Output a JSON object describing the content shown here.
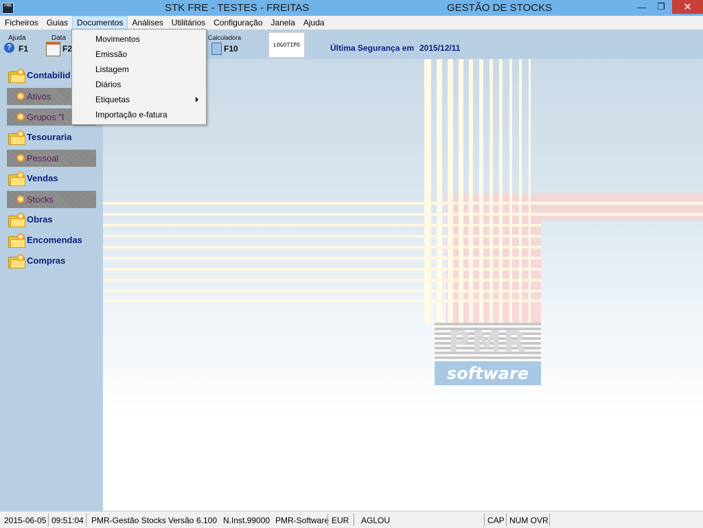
{
  "window": {
    "icon_text": "PMR",
    "title": "STK FRE - TESTES - FREITAS",
    "subtitle": "GESTÃO DE STOCKS",
    "min_glyph": "—",
    "max_glyph": "❐",
    "close_glyph": "✕"
  },
  "menubar": {
    "items": [
      "Ficheiros",
      "Guias",
      "Documentos",
      "Análises",
      "Utilitários",
      "Configuração",
      "Janela",
      "Ajuda"
    ],
    "open_index": 2
  },
  "toolbar": {
    "help_label": "Ajuda",
    "help_key": "F1",
    "help_glyph": "?",
    "date_label": "Data",
    "date_key": "F2",
    "calc_label": "Calculadora",
    "calc_key": "F10",
    "logo_text": "LOGOTIPO",
    "backup_label": "Última Segurança em",
    "backup_date": "2015/12/11"
  },
  "dropdown": {
    "items": [
      "Movimentos",
      "Emissão",
      "Listagem",
      "Diários",
      "Etiquetas",
      "Importação e-fatura"
    ],
    "submenu_index": 4
  },
  "sidebar": {
    "contabilidade": "Contabilid",
    "ativos": "Ativos",
    "grupos": "Grupos \"I",
    "tesouraria": "Tesouraria",
    "pessoal": "Pessoal",
    "vendas": "Vendas",
    "stocks": "Stocks",
    "obras": "Obras",
    "encomendas": "Encomendas",
    "compras": "Compras"
  },
  "branding": {
    "pmr": "PMR",
    "software": "software"
  },
  "statusbar": {
    "date": "2015-06-05",
    "time": "09:51:04",
    "app": "PMR-Gestão Stocks",
    "version_label": "Versão",
    "version": "6.100",
    "inst": "N.Inst.99000",
    "vendor": "PMR-Software",
    "currency": "EUR",
    "user": "AGLOU",
    "cap": "CAP",
    "num_ovr": "NUM OVR"
  },
  "colors": {
    "titlebar": "#6fb3ea",
    "panel": "#b8cfe3",
    "close": "#c7413a",
    "nav_text": "#0b1f7a"
  }
}
